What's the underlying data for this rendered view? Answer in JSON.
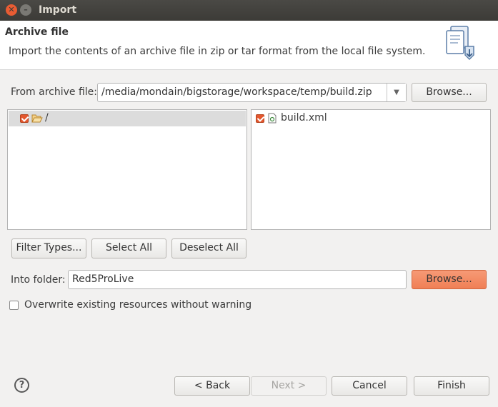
{
  "window": {
    "title": "Import"
  },
  "header": {
    "title": "Archive file",
    "description": "Import the contents of an archive file in zip or tar format from the local file system."
  },
  "source": {
    "label": "From archive file:",
    "value": "/media/mondain/bigstorage/workspace/temp/build.zip",
    "browse_label": "Browse..."
  },
  "tree": {
    "folders": [
      {
        "label": "/",
        "checked": true,
        "icon": "folder-open-icon"
      }
    ],
    "files": [
      {
        "label": "build.xml",
        "checked": true,
        "icon": "xml-file-icon"
      }
    ]
  },
  "selection_buttons": {
    "filter_types": "Filter Types...",
    "select_all": "Select All",
    "deselect_all": "Deselect All"
  },
  "destination": {
    "label": "Into folder:",
    "value": "Red5ProLive",
    "browse_label": "Browse..."
  },
  "options": {
    "overwrite_label": "Overwrite existing resources without warning",
    "overwrite_checked": false
  },
  "footer": {
    "help": "?",
    "back": "< Back",
    "next": "Next >",
    "cancel": "Cancel",
    "finish": "Finish"
  },
  "colors": {
    "accent": "#f07f55",
    "checkbox_checked": "#e4572e",
    "titlebar": "#3c3b37"
  }
}
